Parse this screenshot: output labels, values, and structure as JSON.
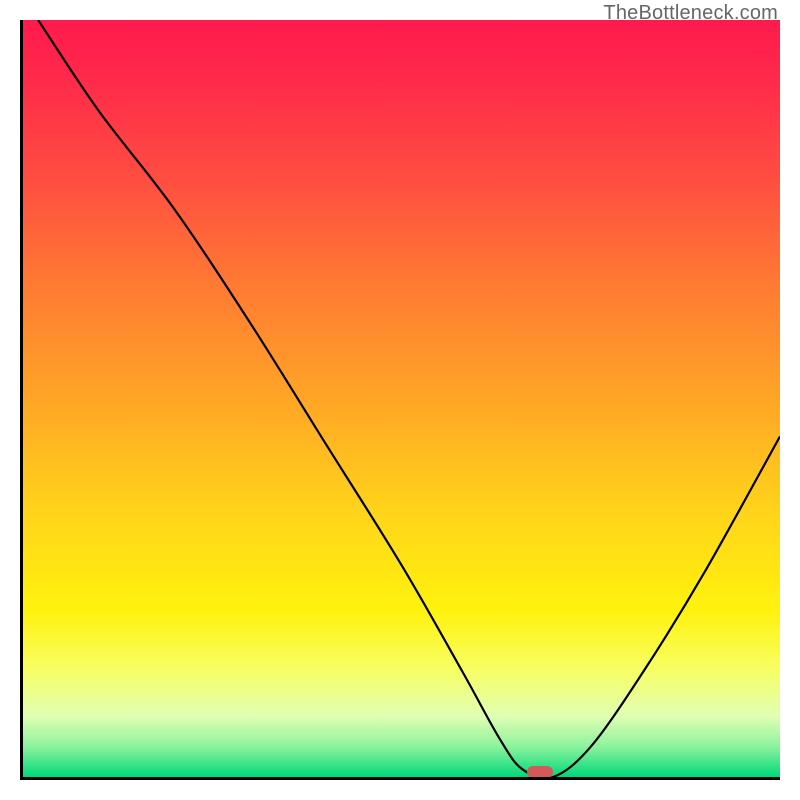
{
  "watermark": "TheBottleneck.com",
  "chart_data": {
    "type": "line",
    "title": "",
    "xlabel": "",
    "ylabel": "",
    "xlim": [
      0,
      100
    ],
    "ylim": [
      0,
      100
    ],
    "grid": false,
    "background_gradient": [
      "#ff1a4d",
      "#ff7a33",
      "#ffd41a",
      "#fff20d",
      "#00d97a"
    ],
    "series": [
      {
        "name": "bottleneck-curve",
        "color": "#000000",
        "x": [
          2,
          10,
          20,
          30,
          40,
          50,
          58,
          63,
          66,
          70,
          75,
          82,
          90,
          100
        ],
        "values": [
          100,
          88,
          75,
          60,
          44,
          28,
          14,
          5,
          1,
          0,
          4,
          14,
          27,
          45
        ]
      }
    ],
    "marker": {
      "name": "optimal-point",
      "x": 68,
      "y": 1,
      "color": "#d45a5a"
    }
  }
}
